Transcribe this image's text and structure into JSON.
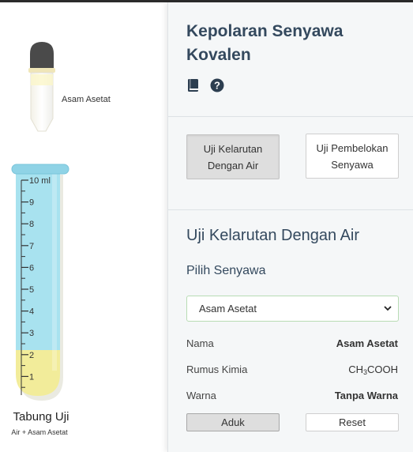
{
  "simulation": {
    "dropper_label": "Asam Asetat",
    "tube_ticks": [
      "10 ml",
      "9",
      "8",
      "7",
      "6",
      "5",
      "4",
      "3",
      "2",
      "1"
    ],
    "tube_title": "Tabung Uji",
    "tube_subtitle": "Air + Asam Asetat",
    "water_level_ml": 10,
    "solute_level_ml": 2,
    "colors": {
      "water": "#a8e2ef",
      "solute": "#f2ec9a",
      "dropper_bulb": "#4a4a4a"
    }
  },
  "panel": {
    "title": "Kepolaran Senyawa Kovalen",
    "icons": [
      "book-icon",
      "question-circle-icon"
    ],
    "tabs": [
      {
        "label": "Uji Kelarutan Dengan Air",
        "active": true
      },
      {
        "label": "Uji Pembelokan Senyawa",
        "active": false
      }
    ],
    "section_title": "Uji Kelarutan Dengan Air",
    "choose_label": "Pilih Senyawa",
    "select_value": "Asam Asetat",
    "properties": {
      "name_label": "Nama",
      "name_value": "Asam Asetat",
      "formula_label": "Rumus Kimia",
      "formula_prefix": "CH",
      "formula_sub": "3",
      "formula_suffix": "COOH",
      "color_label": "Warna",
      "color_value": "Tanpa Warna"
    },
    "buttons": {
      "stir": "Aduk",
      "reset": "Reset"
    }
  }
}
